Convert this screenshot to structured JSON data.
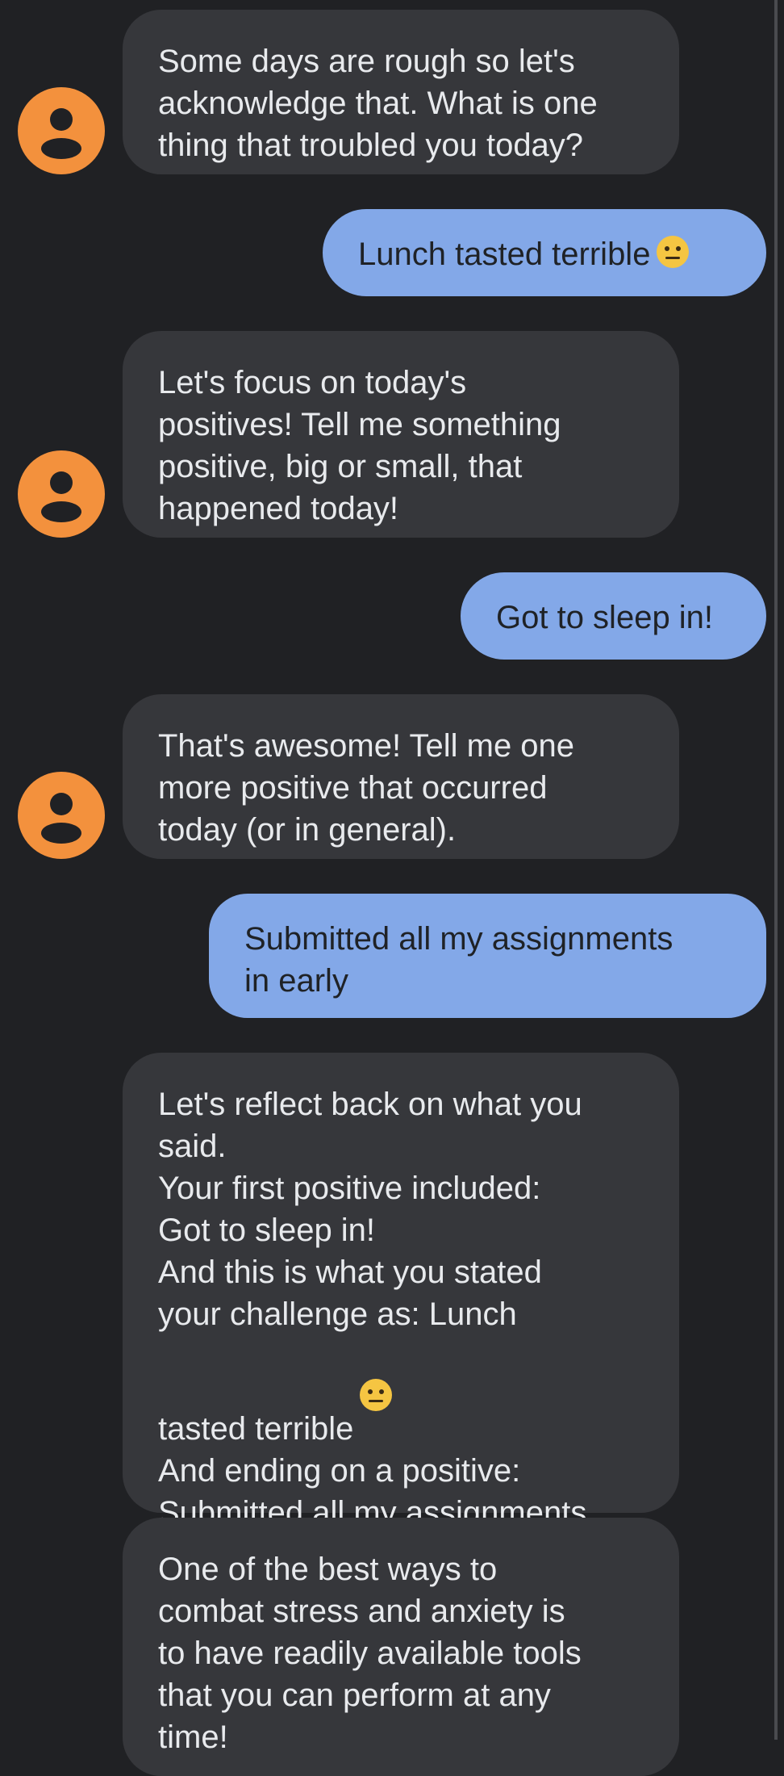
{
  "conversation": {
    "messages": [
      {
        "sender": "bot",
        "text": "Some days are rough so let's\nacknowledge that. What is one\nthing that troubled you today?"
      },
      {
        "sender": "user",
        "text": "Lunch tasted terrible",
        "emoji": "neutral-face"
      },
      {
        "sender": "bot",
        "text": "Let's focus on today's\npositives! Tell me something\npositive, big or small, that\nhappened today!"
      },
      {
        "sender": "user",
        "text": "Got to sleep in!"
      },
      {
        "sender": "bot",
        "text": "That's awesome! Tell me one\nmore positive that occurred\ntoday (or in general)."
      },
      {
        "sender": "user",
        "text": "Submitted all my assignments\nin early"
      },
      {
        "sender": "bot",
        "text_before_emoji": "Let's reflect back on what you\nsaid.\nYour first positive included:\nGot to sleep in!\nAnd this is what you stated\nyour challenge as: Lunch\ntasted terrible",
        "emoji": "neutral-face",
        "text_after_emoji": "\nAnd ending on a positive:\nSubmitted all my assignments\nin early"
      },
      {
        "sender": "bot",
        "text": "One of the best ways to\ncombat stress and anxiety is\nto have readily available tools\nthat you can perform at any\ntime!"
      }
    ]
  },
  "colors": {
    "background": "#202124",
    "bot_bubble": "#36373b",
    "user_bubble": "#83a8e8",
    "avatar": "#f3913d"
  },
  "icons": {
    "avatar": "person-icon",
    "emoji": "neutral-face-emoji"
  }
}
